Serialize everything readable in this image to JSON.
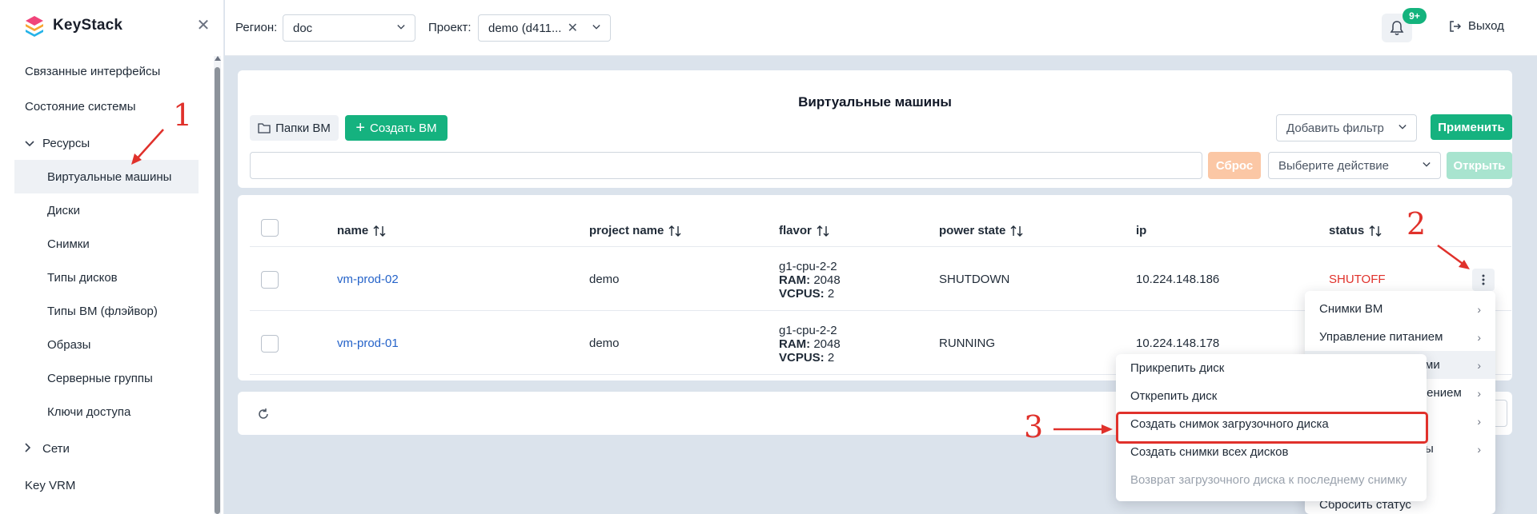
{
  "app": {
    "name": "KeyStack"
  },
  "sidebar": {
    "items": [
      {
        "label": "Связанные интерфейсы"
      },
      {
        "label": "Состояние системы"
      },
      {
        "label": "Ресурсы"
      },
      {
        "label": "Виртуальные машины"
      },
      {
        "label": "Диски"
      },
      {
        "label": "Снимки"
      },
      {
        "label": "Типы дисков"
      },
      {
        "label": "Типы ВМ (флэйвор)"
      },
      {
        "label": "Образы"
      },
      {
        "label": "Серверные группы"
      },
      {
        "label": "Ключи доступа"
      },
      {
        "label": "Сети"
      },
      {
        "label": "Key VRM"
      }
    ]
  },
  "header": {
    "region_label": "Регион:",
    "region_value": "doc",
    "project_label": "Проект:",
    "project_value": "demo (d411...",
    "notifications_badge": "9+",
    "logout_label": "Выход"
  },
  "toolbar": {
    "title": "Виртуальные машины",
    "folders_button": "Папки ВМ",
    "create_button": "Создать ВМ",
    "filter_select": "Добавить фильтр",
    "apply_button": "Применить",
    "search_value": "",
    "reset_button": "Сброс",
    "action_select": "Выберите действие",
    "open_button": "Открыть"
  },
  "table": {
    "columns": [
      "name",
      "project name",
      "flavor",
      "power state",
      "ip",
      "status"
    ],
    "rows": [
      {
        "name": "vm-prod-02",
        "project": "demo",
        "flavor_name": "g1-cpu-2-2",
        "ram_label": "RAM:",
        "ram": "2048",
        "vcpus_label": "VCPUS:",
        "vcpus": "2",
        "power_state": "SHUTDOWN",
        "ip": "10.224.148.186",
        "status": "SHUTOFF"
      },
      {
        "name": "vm-prod-01",
        "project": "demo",
        "flavor_name": "g1-cpu-2-2",
        "ram_label": "RAM:",
        "ram": "2048",
        "vcpus_label": "VCPUS:",
        "vcpus": "2",
        "power_state": "RUNNING",
        "ip": "10.224.148.178",
        "status": ""
      }
    ]
  },
  "context_menu": {
    "items": [
      {
        "label": "Снимки ВМ"
      },
      {
        "label": "Управление питанием"
      },
      {
        "label": "ми"
      },
      {
        "label": "щением"
      },
      {
        "label": ""
      },
      {
        "label": "ы"
      },
      {
        "label": "Сбросить статус"
      }
    ]
  },
  "submenu": {
    "items": [
      {
        "label": "Прикрепить диск"
      },
      {
        "label": "Открепить диск"
      },
      {
        "label": "Создать снимок загрузочного диска"
      },
      {
        "label": "Создать снимки всех дисков"
      },
      {
        "label": "Возврат загрузочного диска к последнему снимку"
      }
    ]
  },
  "annotations": [
    "1",
    "2",
    "3"
  ],
  "colors": {
    "accent_green": "#15b27f",
    "link_blue": "#2563c9",
    "status_red": "#e0312b",
    "annotation_red": "#e0312b"
  },
  "icons": [
    "logo-icon",
    "close-icon",
    "chevron-down-icon",
    "chevron-right-icon",
    "clear-icon",
    "bell-icon",
    "logout-icon",
    "folder-icon",
    "plus-icon",
    "sort-icon",
    "kebab-icon",
    "refresh-icon"
  ]
}
